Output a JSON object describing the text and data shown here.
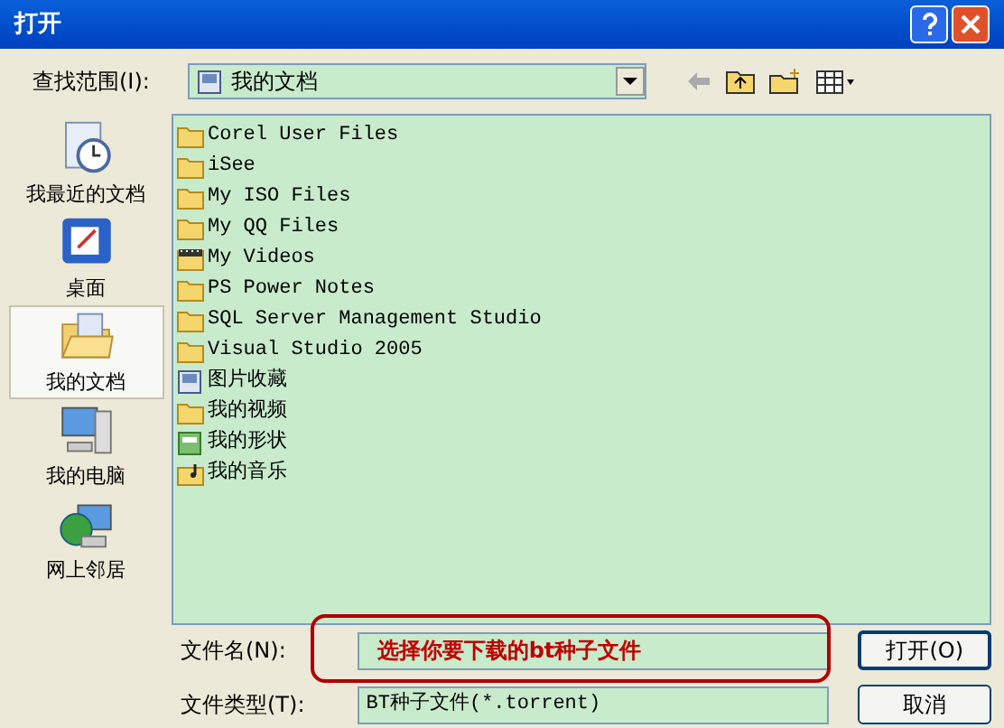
{
  "window": {
    "title": "打开"
  },
  "look_in": {
    "label": "查找范围(I):",
    "value": "我的文档"
  },
  "sidebar": {
    "items": [
      {
        "label": "我最近的文档",
        "kind": "recent",
        "selected": false
      },
      {
        "label": "桌面",
        "kind": "desktop",
        "selected": false
      },
      {
        "label": "我的文档",
        "kind": "documents",
        "selected": true
      },
      {
        "label": "我的电脑",
        "kind": "computer",
        "selected": false
      },
      {
        "label": "网上邻居",
        "kind": "network",
        "selected": false
      }
    ]
  },
  "files": [
    {
      "name": "Corel User Files",
      "kind": "folder"
    },
    {
      "name": "iSee",
      "kind": "folder"
    },
    {
      "name": "My ISO Files",
      "kind": "folder"
    },
    {
      "name": "My QQ Files",
      "kind": "folder"
    },
    {
      "name": "My Videos",
      "kind": "video"
    },
    {
      "name": "PS Power Notes",
      "kind": "folder"
    },
    {
      "name": "SQL Server Management Studio",
      "kind": "folder"
    },
    {
      "name": "Visual Studio 2005",
      "kind": "folder"
    },
    {
      "name": "图片收藏",
      "kind": "pictures"
    },
    {
      "name": "我的视频",
      "kind": "folder"
    },
    {
      "name": "我的形状",
      "kind": "shapes"
    },
    {
      "name": "我的音乐",
      "kind": "music"
    }
  ],
  "file_name": {
    "label": "文件名(N):",
    "annotation": "选择你要下载的bt种子文件"
  },
  "file_type": {
    "label": "文件类型(T):",
    "value": "BT种子文件(*.torrent)"
  },
  "buttons": [
    {
      "label": "打开(O)",
      "kind": "default"
    },
    {
      "label": "取消",
      "kind": "normal"
    }
  ]
}
